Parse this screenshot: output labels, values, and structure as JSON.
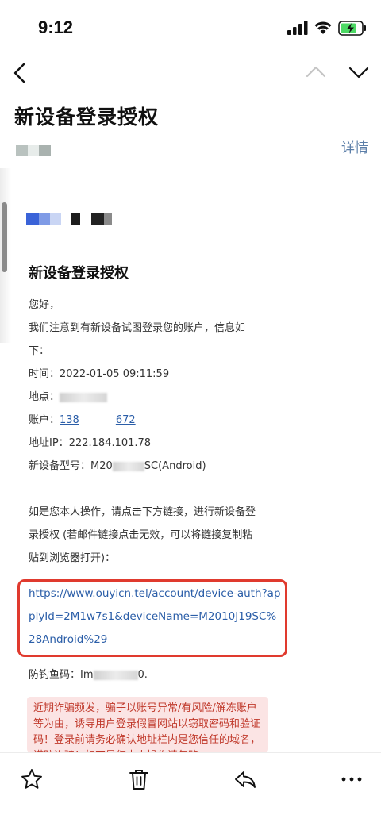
{
  "status_bar": {
    "time": "9:12"
  },
  "email": {
    "subject": "新设备登录授权",
    "details_label": "详情"
  },
  "body": {
    "heading": "新设备登录授权",
    "greeting": "您好，",
    "intro_1": "我们注意到有新设备试图登录您的账户，信息如",
    "intro_2": "下：",
    "time_label": "时间：",
    "time_value": "2022-01-05 09:11:59",
    "location_label": "地点：",
    "account_label": "账户：",
    "account_prefix": "138",
    "account_suffix": "672",
    "ip_label": "地址IP：",
    "ip_value": "222.184.101.78",
    "device_label": "新设备型号：",
    "device_prefix": "M20",
    "device_suffix": "SC(Android)",
    "instruction_1": "如是您本人操作，请点击下方链接，进行新设备登",
    "instruction_2": "录授权 (若邮件链接点击无效，可以将链接复制粘",
    "instruction_3": "贴到浏览器打开)：",
    "auth_link": "https://www.ouyicn.tel/account/device-auth?applyId=2M1w7s1&deviceName=M2010J19SC%28Android%29",
    "anti_phishing_label": "防钓鱼码：",
    "anti_phishing_prefix": "Im",
    "anti_phishing_suffix": "0.",
    "warning_text": "近期诈骗频发，骗子以账号异常/有风险/解冻账户等为由，诱导用户登录假冒网站以窃取密码和验证码！登录前请务必确认地址栏内是您信任的域名，谨防诈骗！如不是您本人操作请忽略"
  },
  "colors": {
    "link": "#2b5ea8",
    "highlight_border": "#e03a2e",
    "warning_bg": "#fbe4e4",
    "warning_text": "#c0392b",
    "details": "#5b7ea8"
  },
  "icons": {
    "back": "chevron-left-icon",
    "prev": "chevron-up-icon",
    "next": "chevron-down-icon",
    "star": "star-icon",
    "delete": "trash-icon",
    "reply": "reply-icon",
    "more": "more-icon"
  }
}
